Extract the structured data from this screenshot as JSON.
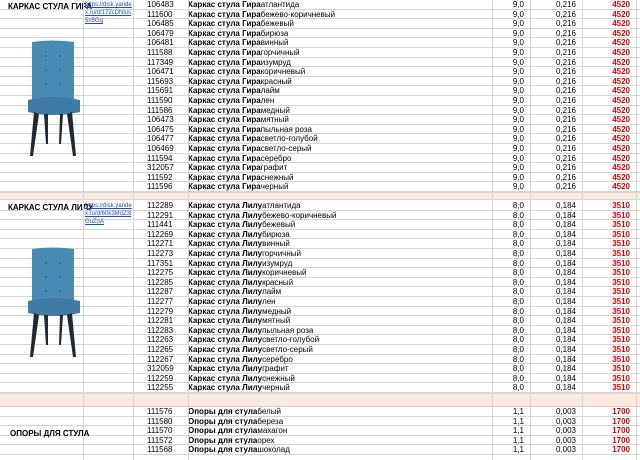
{
  "groups": [
    {
      "title": "КАРКАС СТУЛА ГИРА",
      "link": "https://disk.yandex.ru/d/172cDNlus5n5Gg",
      "rows": [
        {
          "code": "106483",
          "prefix": "Каркас стула Гира",
          "color": "атлантида",
          "weight": "9,0",
          "volume": "0,216",
          "price": "4520"
        },
        {
          "code": "111600",
          "prefix": "Каркас стула Гира",
          "color": "бежево-коричневый",
          "weight": "9,0",
          "volume": "0,216",
          "price": "4520"
        },
        {
          "code": "106485",
          "prefix": "Каркас стула Гира",
          "color": "бежевый",
          "weight": "9,0",
          "volume": "0,216",
          "price": "4520"
        },
        {
          "code": "106479",
          "prefix": "Каркас стула Гира",
          "color": "бирюза",
          "weight": "9,0",
          "volume": "0,216",
          "price": "4520"
        },
        {
          "code": "106481",
          "prefix": "Каркас стула Гира",
          "color": "винный",
          "weight": "9,0",
          "volume": "0,216",
          "price": "4520"
        },
        {
          "code": "111588",
          "prefix": "Каркас стула Гира",
          "color": "горчичный",
          "weight": "9,0",
          "volume": "0,216",
          "price": "4520"
        },
        {
          "code": "117349",
          "prefix": "Каркас стула Гира",
          "color": "изумруд",
          "weight": "9,0",
          "volume": "0,216",
          "price": "4520"
        },
        {
          "code": "106471",
          "prefix": "Каркас стула Гира",
          "color": "коричневый",
          "weight": "9,0",
          "volume": "0,216",
          "price": "4520"
        },
        {
          "code": "115693",
          "prefix": "Каркас стула Гира",
          "color": "красный",
          "weight": "9,0",
          "volume": "0,216",
          "price": "4520"
        },
        {
          "code": "115691",
          "prefix": "Каркас стула Гира",
          "color": "лайм",
          "weight": "9,0",
          "volume": "0,216",
          "price": "4520"
        },
        {
          "code": "111590",
          "prefix": "Каркас стула Гира",
          "color": "лен",
          "weight": "9,0",
          "volume": "0,216",
          "price": "4520"
        },
        {
          "code": "111586",
          "prefix": "Каркас стула Гира",
          "color": "медный",
          "weight": "9,0",
          "volume": "0,216",
          "price": "4520"
        },
        {
          "code": "106473",
          "prefix": "Каркас стула Гира",
          "color": "мятный",
          "weight": "9,0",
          "volume": "0,216",
          "price": "4520"
        },
        {
          "code": "106475",
          "prefix": "Каркас стула Гира",
          "color": "пыльная роза",
          "weight": "9,0",
          "volume": "0,216",
          "price": "4520"
        },
        {
          "code": "106477",
          "prefix": "Каркас стула Гира",
          "color": "светло-голубой",
          "weight": "9,0",
          "volume": "0,216",
          "price": "4520"
        },
        {
          "code": "106469",
          "prefix": "Каркас стула Гира",
          "color": "светло-серый",
          "weight": "9,0",
          "volume": "0,216",
          "price": "4520"
        },
        {
          "code": "111594",
          "prefix": "Каркас стула Гира",
          "color": "серебро",
          "weight": "9,0",
          "volume": "0,216",
          "price": "4520"
        },
        {
          "code": "312057",
          "prefix": "Каркас стула Гира",
          "color": "графит",
          "weight": "9,0",
          "volume": "0,216",
          "price": "4520"
        },
        {
          "code": "111592",
          "prefix": "Каркас стула Гира",
          "color": "снежный",
          "weight": "9,0",
          "volume": "0,216",
          "price": "4520"
        },
        {
          "code": "111596",
          "prefix": "Каркас стула Гира",
          "color": "черный",
          "weight": "9,0",
          "volume": "0,216",
          "price": "4520"
        }
      ]
    },
    {
      "title": "КАРКАС СТУЛА ЛИЛУ",
      "link": "https://disk.yandex.ru/d/60k3MdZ3lGuZoA",
      "rows": [
        {
          "code": "112289",
          "prefix": "Каркас стула Лилу",
          "color": "атлантида",
          "weight": "8,0",
          "volume": "0,184",
          "price": "3510"
        },
        {
          "code": "112291",
          "prefix": "Каркас стула Лилу",
          "color": "бежево-коричневый",
          "weight": "8,0",
          "volume": "0,184",
          "price": "3510"
        },
        {
          "code": "111441",
          "prefix": "Каркас стула Лилу",
          "color": "бежевый",
          "weight": "8,0",
          "volume": "0,184",
          "price": "3510"
        },
        {
          "code": "112269",
          "prefix": "Каркас стула Лилу",
          "color": "бирюза",
          "weight": "8,0",
          "volume": "0,184",
          "price": "3510"
        },
        {
          "code": "112271",
          "prefix": "Каркас стула Лилу",
          "color": "винный",
          "weight": "8,0",
          "volume": "0,184",
          "price": "3510"
        },
        {
          "code": "112273",
          "prefix": "Каркас стула Лилу",
          "color": "горчичный",
          "weight": "8,0",
          "volume": "0,184",
          "price": "3510"
        },
        {
          "code": "117351",
          "prefix": "Каркас стула Лилу",
          "color": "изумруд",
          "weight": "8,0",
          "volume": "0,184",
          "price": "3510"
        },
        {
          "code": "112275",
          "prefix": "Каркас стула Лилу",
          "color": "коричневый",
          "weight": "8,0",
          "volume": "0,184",
          "price": "3510"
        },
        {
          "code": "112285",
          "prefix": "Каркас стула Лилу",
          "color": "красный",
          "weight": "8,0",
          "volume": "0,184",
          "price": "3510"
        },
        {
          "code": "112287",
          "prefix": "Каркас стула Лилу",
          "color": "лайм",
          "weight": "8,0",
          "volume": "0,184",
          "price": "3510"
        },
        {
          "code": "112277",
          "prefix": "Каркас стула Лилу",
          "color": "лен",
          "weight": "8,0",
          "volume": "0,184",
          "price": "3510"
        },
        {
          "code": "112279",
          "prefix": "Каркас стула Лилу",
          "color": "медный",
          "weight": "8,0",
          "volume": "0,184",
          "price": "3510"
        },
        {
          "code": "112281",
          "prefix": "Каркас стула Лилу",
          "color": "мятный",
          "weight": "8,0",
          "volume": "0,184",
          "price": "3510"
        },
        {
          "code": "112283",
          "prefix": "Каркас стула Лилу",
          "color": "пыльная роза",
          "weight": "8,0",
          "volume": "0,184",
          "price": "3510"
        },
        {
          "code": "112263",
          "prefix": "Каркас стула Лилу",
          "color": "светло-голубой",
          "weight": "8,0",
          "volume": "0,184",
          "price": "3510"
        },
        {
          "code": "112265",
          "prefix": "Каркас стула Лилу",
          "color": "светло-серый",
          "weight": "8,0",
          "volume": "0,184",
          "price": "3510"
        },
        {
          "code": "112267",
          "prefix": "Каркас стула Лилу",
          "color": "серебро",
          "weight": "8,0",
          "volume": "0,184",
          "price": "3510"
        },
        {
          "code": "312059",
          "prefix": "Каркас стула Лилу",
          "color": "графит",
          "weight": "8,0",
          "volume": "0,184",
          "price": "3510"
        },
        {
          "code": "112259",
          "prefix": "Каркас стула Лилу",
          "color": "снежный",
          "weight": "8,0",
          "volume": "0,184",
          "price": "3510"
        },
        {
          "code": "112255",
          "prefix": "Каркас стула Лилу",
          "color": "черный",
          "weight": "8,0",
          "volume": "0,184",
          "price": "3510"
        }
      ]
    },
    {
      "title": "ОПОРЫ ДЛЯ СТУЛА",
      "link": "",
      "rows": [
        {
          "code": "111576",
          "prefix": "Опоры для стула",
          "color": "белый",
          "weight": "1,1",
          "volume": "0,003",
          "price": "1700"
        },
        {
          "code": "111580",
          "prefix": "Опоры для стула",
          "color": "береза",
          "weight": "1,1",
          "volume": "0,003",
          "price": "1700"
        },
        {
          "code": "111570",
          "prefix": "Опоры для стула",
          "color": "махагон",
          "weight": "1,1",
          "volume": "0,003",
          "price": "1700"
        },
        {
          "code": "111572",
          "prefix": "Опоры для стула",
          "color": "орех",
          "weight": "1,1",
          "volume": "0,003",
          "price": "1700"
        },
        {
          "code": "111568",
          "prefix": "Опоры для стула",
          "color": "шоколад",
          "weight": "1,1",
          "volume": "0,003",
          "price": "1700"
        }
      ]
    }
  ],
  "colors": {
    "price": "#e00000",
    "separator": "#fde9d9",
    "grid": "#d4d4d4",
    "chair_fabric": "#4a8bb3",
    "chair_legs": "#1e2a33"
  },
  "icons": [
    "chair-image"
  ]
}
